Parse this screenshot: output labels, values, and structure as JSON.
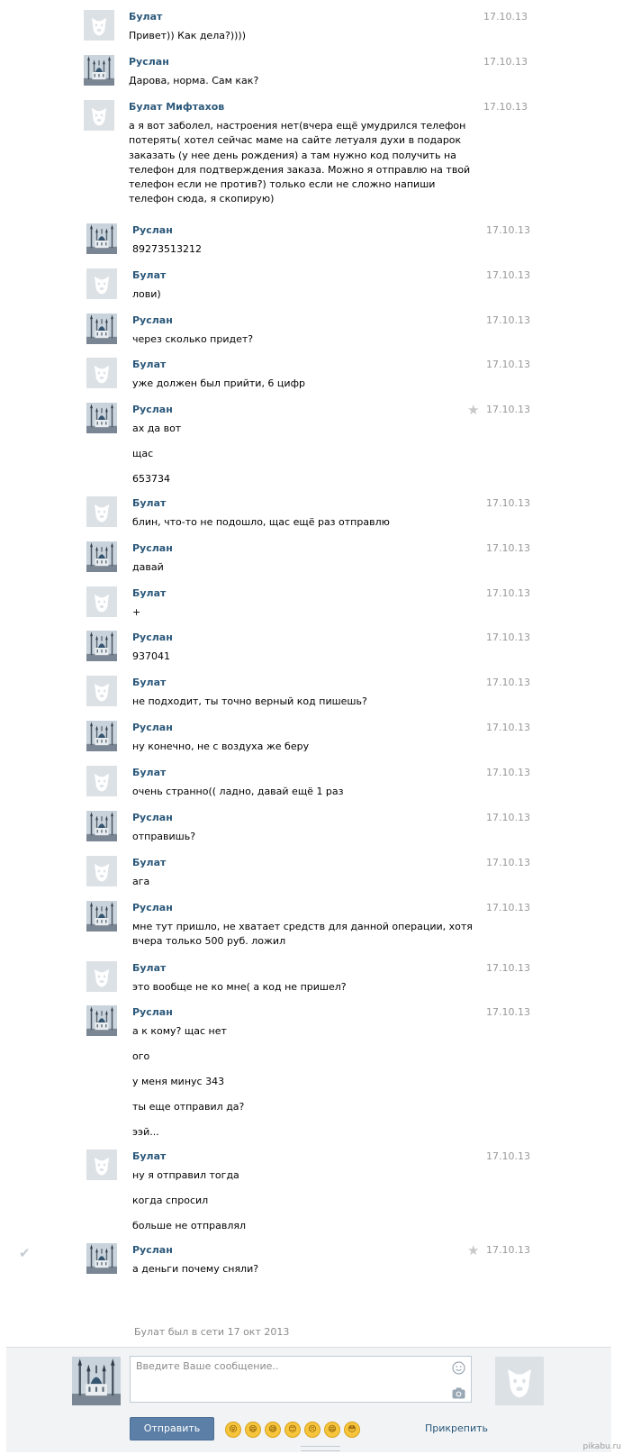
{
  "messages": [
    {
      "kind": "b",
      "author": "Булат",
      "date": "17.10.13",
      "lines": [
        "Привет)) Как дела?))))"
      ]
    },
    {
      "kind": "r",
      "author": "Руслан",
      "date": "17.10.13",
      "lines": [
        "Дарова, норма. Сам как?"
      ]
    },
    {
      "kind": "b",
      "author": "Булат Мифтахов",
      "date": "17.10.13",
      "lines": [
        "а я вот заболел, настроения нет(вчера ещё умудрился телефон",
        "потерять( хотел сейчас маме на сайте летуаля духи в подарок",
        "заказать (у нее день рождения) а там нужно код получить на",
        "телефон для подтверждения заказа. Можно я отправлю на твой",
        "телефон если не против?) только если не сложно напиши",
        "телефон сюда, я скопирую)"
      ]
    },
    {
      "kind": "r",
      "author": "Руслан",
      "date": "17.10.13",
      "lines": [
        "89273513212"
      ]
    },
    {
      "kind": "b",
      "author": "Булат",
      "date": "17.10.13",
      "lines": [
        "лови)"
      ]
    },
    {
      "kind": "r",
      "author": "Руслан",
      "date": "17.10.13",
      "lines": [
        "через сколько придет?"
      ]
    },
    {
      "kind": "b",
      "author": "Булат",
      "date": "17.10.13",
      "lines": [
        "уже должен был прийти, 6 цифр"
      ]
    },
    {
      "kind": "r",
      "author": "Руслан",
      "date": "17.10.13",
      "star": true,
      "lines": [
        "ах да вот",
        "щас",
        "653734"
      ]
    },
    {
      "kind": "b",
      "author": "Булат",
      "date": "17.10.13",
      "lines": [
        "блин, что-то не подошло, щас ещё раз отправлю"
      ]
    },
    {
      "kind": "r",
      "author": "Руслан",
      "date": "17.10.13",
      "lines": [
        "давай"
      ]
    },
    {
      "kind": "b",
      "author": "Булат",
      "date": "17.10.13",
      "lines": [
        "+"
      ]
    },
    {
      "kind": "r",
      "author": "Руслан",
      "date": "17.10.13",
      "lines": [
        "937041"
      ]
    },
    {
      "kind": "b",
      "author": "Булат",
      "date": "17.10.13",
      "lines": [
        "не подходит, ты точно верный код пишешь?"
      ]
    },
    {
      "kind": "r",
      "author": "Руслан",
      "date": "17.10.13",
      "lines": [
        "ну конечно, не с воздуха же беру"
      ]
    },
    {
      "kind": "b",
      "author": "Булат",
      "date": "17.10.13",
      "lines": [
        "очень странно(( ладно, давай ещё 1 раз"
      ]
    },
    {
      "kind": "r",
      "author": "Руслан",
      "date": "17.10.13",
      "lines": [
        "отправишь?"
      ]
    },
    {
      "kind": "b",
      "author": "Булат",
      "date": "17.10.13",
      "lines": [
        "ага"
      ]
    },
    {
      "kind": "r",
      "author": "Руслан",
      "date": "17.10.13",
      "lines": [
        "мне тут пришло, не хватает средств для данной операции, хотя",
        "вчера только 500 руб. ложил"
      ]
    },
    {
      "kind": "b",
      "author": "Булат",
      "date": "17.10.13",
      "lines": [
        "это вообще не ко мне( а код не пришел?"
      ]
    },
    {
      "kind": "r",
      "author": "Руслан",
      "date": "17.10.13",
      "lines": [
        "а к кому? щас нет",
        "ого",
        "у меня минус 343",
        "ты еще отправил да?",
        "ээй..."
      ]
    },
    {
      "kind": "b",
      "author": "Булат",
      "date": "17.10.13",
      "lines": [
        "ну я отправил тогда",
        "когда спросил",
        "больше не отправлял"
      ]
    },
    {
      "kind": "r",
      "author": "Руслан",
      "date": "17.10.13",
      "star": true,
      "check": true,
      "lines": [
        "а деньги почему сняли?"
      ]
    }
  ],
  "status": "Булат был в сети 17 окт 2013",
  "composer": {
    "placeholder": "Введите Ваше сообщение..",
    "send_label": "Отправить",
    "attach_label": "Прикрепить",
    "emojis": [
      "😝",
      "😄",
      "😅",
      "😊",
      "😣",
      "😄",
      "😳"
    ]
  },
  "watermark": "pikabu.ru",
  "colors": {
    "author": "#2b587a",
    "date": "#999999",
    "send_button": "#5b7fa6",
    "compose_bg": "#f1f3f5"
  }
}
